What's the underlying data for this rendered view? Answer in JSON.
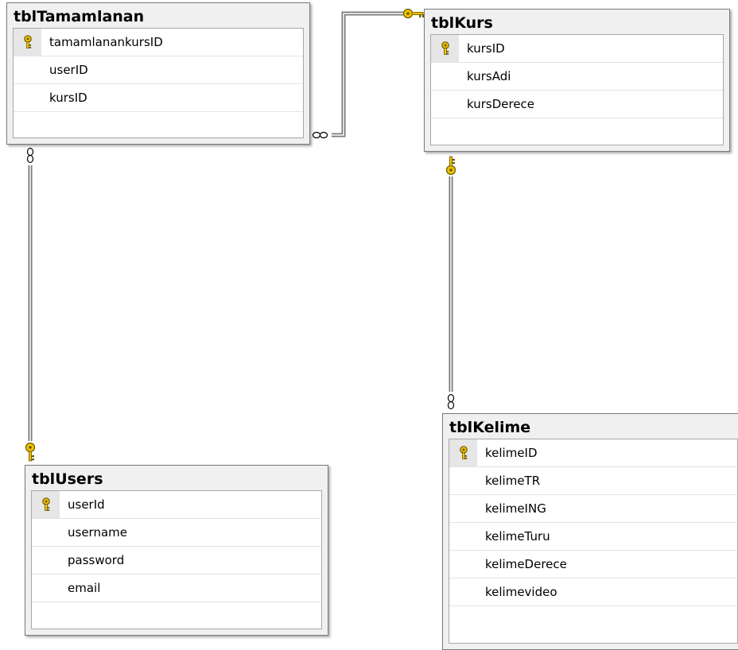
{
  "diagram": {
    "tables": [
      {
        "name": "tblTamamlanan",
        "columns": [
          {
            "name": "tamamlanankursID",
            "primary_key": true
          },
          {
            "name": "userID",
            "primary_key": false
          },
          {
            "name": "kursID",
            "primary_key": false
          }
        ]
      },
      {
        "name": "tblKurs",
        "columns": [
          {
            "name": "kursID",
            "primary_key": true
          },
          {
            "name": "kursAdi",
            "primary_key": false
          },
          {
            "name": "kursDerece",
            "primary_key": false
          }
        ]
      },
      {
        "name": "tblUsers",
        "columns": [
          {
            "name": "userId",
            "primary_key": true
          },
          {
            "name": "username",
            "primary_key": false
          },
          {
            "name": "password",
            "primary_key": false
          },
          {
            "name": "email",
            "primary_key": false
          }
        ]
      },
      {
        "name": "tblKelime",
        "columns": [
          {
            "name": "kelimeID",
            "primary_key": true
          },
          {
            "name": "kelimeTR",
            "primary_key": false
          },
          {
            "name": "kelimeING",
            "primary_key": false
          },
          {
            "name": "kelimeTuru",
            "primary_key": false
          },
          {
            "name": "kelimeDerece",
            "primary_key": false
          },
          {
            "name": "kelimevideo",
            "primary_key": false
          }
        ]
      }
    ],
    "relationships": [
      {
        "from_table": "tblTamamlanan",
        "to_table": "tblKurs",
        "from_end": "many",
        "to_end": "one"
      },
      {
        "from_table": "tblTamamlanan",
        "to_table": "tblUsers",
        "from_end": "many",
        "to_end": "one"
      },
      {
        "from_table": "tblKelime",
        "to_table": "tblKurs",
        "from_end": "many",
        "to_end": "one"
      }
    ],
    "colors": {
      "key": "#f2c200",
      "key_outline": "#6b5a00",
      "connector": "#7a7a7a",
      "table_bg": "#f0f0f0"
    }
  }
}
